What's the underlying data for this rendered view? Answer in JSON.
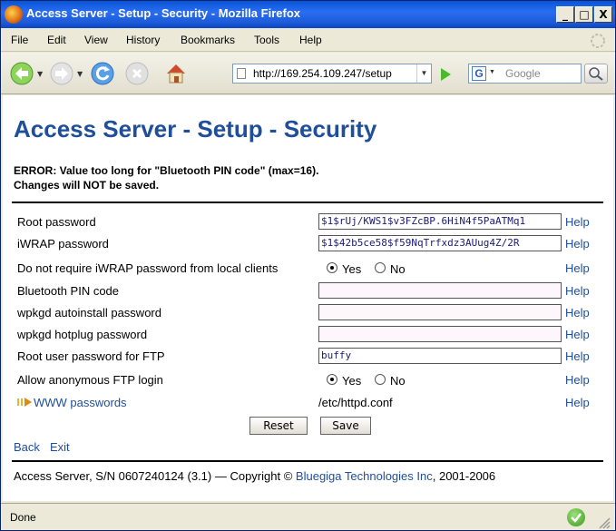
{
  "window": {
    "title": "Access Server - Setup - Security - Mozilla Firefox",
    "minimize_glyph": "_",
    "maximize_glyph": "□",
    "close_glyph": "X"
  },
  "menu": [
    "File",
    "Edit",
    "View",
    "History",
    "Bookmarks",
    "Tools",
    "Help"
  ],
  "toolbar": {
    "url": "http://169.254.109.247/setup",
    "search_placeholder": "Google",
    "search_engine_letter": "G"
  },
  "page": {
    "title": "Access Server - Setup - Security",
    "error_line1": "ERROR: Value too long for \"Bluetooth PIN code\" (max=16).",
    "error_line2": "Changes will NOT be saved.",
    "help_label": "Help",
    "rows": {
      "root_password": {
        "label": "Root password",
        "value": "$1$rUj/KWS1$v3FZcBP.6HiN4f5PaATMq1"
      },
      "iwrap_password": {
        "label": "iWRAP password",
        "value": "$1$42b5ce58$f59NqTrfxdz3AUug4Z/2R"
      },
      "iwrap_local": {
        "label": "Do not require iWRAP password from local clients",
        "yes": "Yes",
        "no": "No",
        "selected": "Yes"
      },
      "bt_pin": {
        "label": "Bluetooth PIN code",
        "value": ""
      },
      "wpkgd_autoinstall": {
        "label": "wpkgd autoinstall password",
        "value": ""
      },
      "wpkgd_hotplug": {
        "label": "wpkgd hotplug password",
        "value": ""
      },
      "ftp_root": {
        "label": "Root user password for FTP",
        "value": "buffy"
      },
      "ftp_anon": {
        "label": "Allow anonymous FTP login",
        "yes": "Yes",
        "no": "No",
        "selected": "Yes"
      },
      "www_passwords": {
        "label": "WWW passwords",
        "value": "/etc/httpd.conf"
      }
    },
    "reset_label": "Reset",
    "save_label": "Save",
    "back_label": "Back",
    "exit_label": "Exit",
    "footer_prefix": "Access Server, S/N 0607240124 (3.1) — Copyright ©",
    "footer_company": "Bluegiga Technologies Inc",
    "footer_suffix": ", 2001-2006"
  },
  "status": {
    "text": "Done"
  }
}
